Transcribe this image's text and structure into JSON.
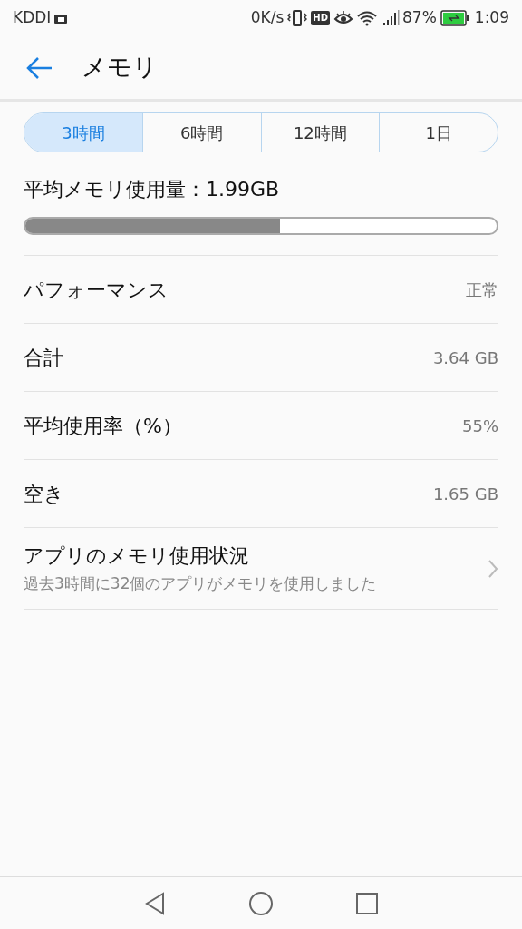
{
  "status_bar": {
    "carrier": "KDDI",
    "speed": "0K/s",
    "hd": "HD",
    "battery": "87%",
    "time": "1:09"
  },
  "header": {
    "title": "メモリ"
  },
  "tabs": [
    {
      "label": "3時間",
      "selected": true
    },
    {
      "label": "6時間",
      "selected": false
    },
    {
      "label": "12時間",
      "selected": false
    },
    {
      "label": "1日",
      "selected": false
    }
  ],
  "average": {
    "label": "平均メモリ使用量：1.99GB",
    "level": 0.54
  },
  "rows": [
    {
      "kind": "value",
      "label": "パフォーマンス",
      "value": "正常"
    },
    {
      "kind": "value",
      "label": "合計",
      "value": "3.64 GB"
    },
    {
      "kind": "value",
      "label": "平均使用率（%）",
      "value": "55%"
    },
    {
      "kind": "value",
      "label": "空き",
      "value": "1.65 GB"
    },
    {
      "kind": "link",
      "label": "アプリのメモリ使用状況",
      "detail": "過去3時間に32個のアプリがメモリを使用しました"
    }
  ]
}
